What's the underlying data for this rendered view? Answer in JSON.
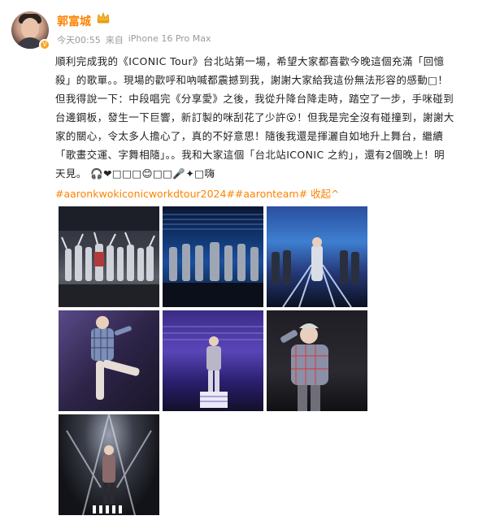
{
  "author": {
    "name": "郭富城"
  },
  "post_meta": {
    "time": "今天00:55",
    "source_prefix": "来自",
    "device": "iPhone 16 Pro Max"
  },
  "post": {
    "lines": [
      "順利完成我的《ICONIC Tour》台北站第一場，希望大家都喜歡今晚這個充滿「回憶",
      "殺」的歌單。。現場的歡呼和吶喊都震撼到我，謝謝大家給我這份無法形容的感動□！",
      "但我得說一下：中段唱完《分享愛》之後，我從升降台降走時，踏空了一步，手咪碰到",
      "台邊鋼板，發生一下巨響，新訂製的咪刮花了少許😮！但我是完全沒有碰撞到，謝謝大",
      "家的關心，令太多人擔心了，真的不好意思！隨後我還是揮灑自如地升上舞台，繼續",
      "「歌畫交運、字舞相隨」。。我和大家這個「台北站ICONIC 之約」，還有2個晚上！明",
      "天見。 🎧❤□□□😊□□🎤✦□嗨"
    ],
    "tags": "#aaronkwokiconicworkdtour2024##aaronteam#",
    "collapse_label": "收起",
    "collapse_icon": "chevron-up-icon"
  },
  "photos": [
    {
      "id": "photo-1"
    },
    {
      "id": "photo-2"
    },
    {
      "id": "photo-3"
    },
    {
      "id": "photo-4"
    },
    {
      "id": "photo-5"
    },
    {
      "id": "photo-6"
    },
    {
      "id": "photo-7"
    }
  ],
  "colors": {
    "accent": "#ff8200",
    "meta_gray": "#9a9a9a",
    "text": "#222222"
  }
}
